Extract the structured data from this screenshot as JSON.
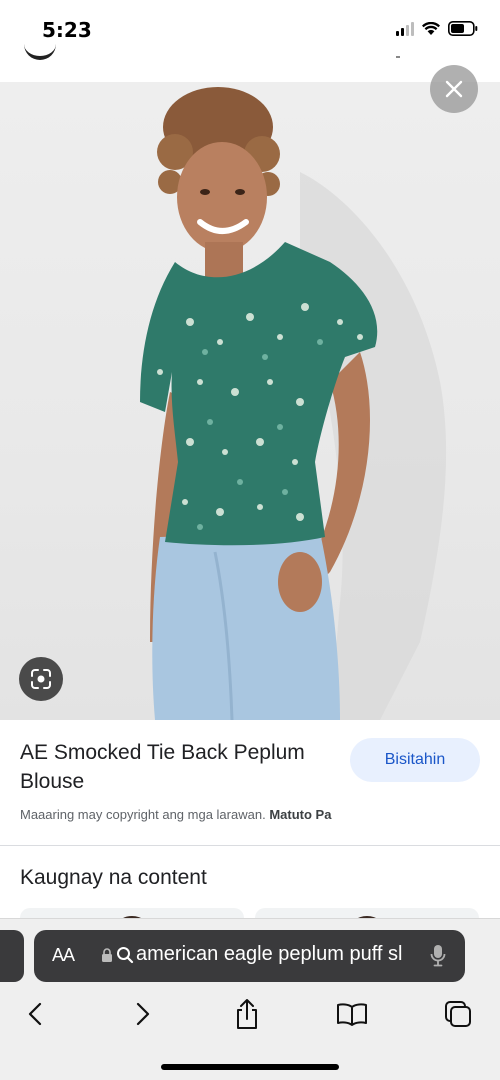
{
  "status": {
    "time": "5:23"
  },
  "product": {
    "title": "AE Smocked Tie Back Peplum Blouse",
    "visit_label": "Bisitahin",
    "copyright_text": "Maaaring may copyright ang mga larawan.",
    "learn_more": "Matuto Pa"
  },
  "related": {
    "heading": "Kaugnay na content"
  },
  "browser": {
    "aa_label": "AA",
    "url": "american eagle peplum puff sl"
  },
  "colors": {
    "top_print": "#2f7a6a",
    "jeans": "#a9c6e0",
    "visit_bg": "#e8f0fe",
    "visit_text": "#1a56c8",
    "toolbar_bg": "#efefef",
    "address_bg": "#3a3a3c"
  },
  "icons": [
    "close-icon",
    "lens-icon",
    "lock-icon",
    "search-icon",
    "microphone-icon",
    "back-icon",
    "forward-icon",
    "share-icon",
    "bookmarks-icon",
    "tabs-icon",
    "signal-icon",
    "wifi-icon",
    "battery-icon"
  ]
}
